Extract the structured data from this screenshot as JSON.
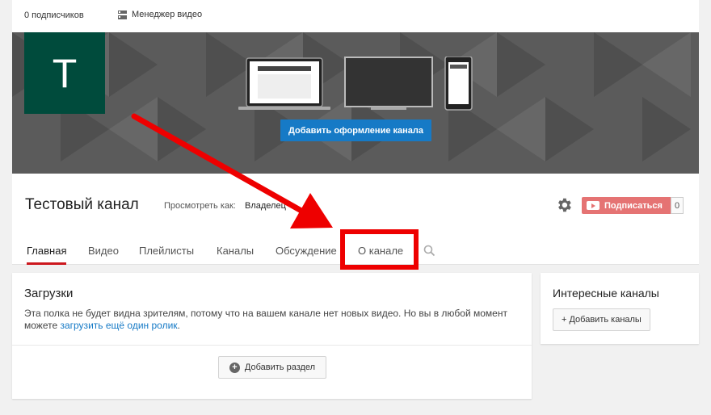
{
  "topbar": {
    "subscribers": "0 подписчиков",
    "video_manager": "Менеджер видео"
  },
  "banner": {
    "avatar_letter": "T",
    "add_art_button": "Добавить оформление канала"
  },
  "channel": {
    "title": "Тестовый канал",
    "view_as_label": "Просмотреть как:",
    "view_as_value": "Владелец",
    "subscribe_label": "Подписаться",
    "subscribe_count": "0"
  },
  "tabs": [
    "Главная",
    "Видео",
    "Плейлисты",
    "Каналы",
    "Обсуждение",
    "О канале"
  ],
  "uploads": {
    "title": "Загрузки",
    "text_before_link": "Эта полка не будет видна зрителям, потому что на вашем канале нет новых видео. Но вы в любой момент можете ",
    "link": "загрузить ещё один ролик",
    "text_after_link": ".",
    "add_section_button": "Добавить раздел"
  },
  "sidebar": {
    "title": "Интересные каналы",
    "add_channels_button": "+ Добавить каналы"
  },
  "colors": {
    "accent_blue": "#167ac6",
    "avatar_bg": "#004b3c",
    "subscribe_red": "#e57373",
    "highlight_red": "#ee0000"
  }
}
